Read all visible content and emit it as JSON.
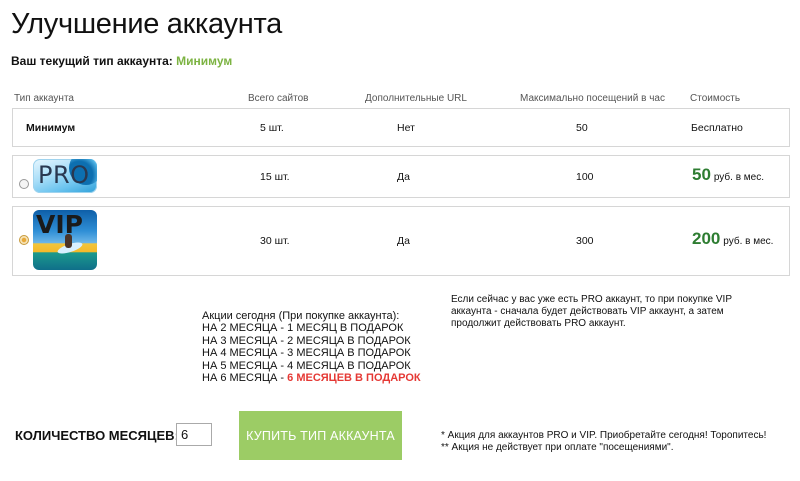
{
  "page": {
    "title": "Улучшение аккаунта",
    "current_type_label": "Ваш текущий тип аккаунта:",
    "current_type_value": "Минимум"
  },
  "columns": {
    "type": "Тип аккаунта",
    "sites": "Всего сайтов",
    "urls": "Дополнительные URL",
    "visits": "Максимально посещений в час",
    "cost": "Стоимость"
  },
  "plans": {
    "minimum": {
      "name": "Минимум",
      "sites": "5 шт.",
      "urls": "Нет",
      "visits": "50",
      "cost": "Бесплатно"
    },
    "pro": {
      "logo": "PRO",
      "sites": "15 шт.",
      "urls": "Да",
      "visits": "100",
      "price": "50",
      "price_unit": "руб. в мес.",
      "selected": false
    },
    "vip": {
      "logo": "VIP",
      "sites": "30 шт.",
      "urls": "Да",
      "visits": "300",
      "price": "200",
      "price_unit": "руб. в мес.",
      "selected": true
    }
  },
  "promo": {
    "heading": "Акции сегодня (При покупке аккаунта):",
    "lines": [
      "НА 2 МЕСЯЦА - 1 МЕСЯЦ В ПОДАРОК",
      "НА 3 МЕСЯЦА - 2 МЕСЯЦА В ПОДАРОК",
      "НА 4 МЕСЯЦА - 3 МЕСЯЦА В ПОДАРОК",
      "НА 5 МЕСЯЦА - 4 МЕСЯЦА В ПОДАРОК"
    ],
    "last_prefix": "НА 6 МЕСЯЦА - ",
    "last_highlight": "6 МЕСЯЦЕВ В ПОДАРОК"
  },
  "note": "Если сейчас у вас уже есть PRO аккаунт, то при покупке VIP аккаунта - сначала будет действовать VIP аккаунт, а затем продолжит действовать PRO аккаунт.",
  "order": {
    "months_label": "КОЛИЧЕСТВО МЕСЯЦЕВ:",
    "months_value": "6",
    "buy_label": "КУПИТЬ ТИП АККАУНТА"
  },
  "footnotes": {
    "one": "* Акция для аккаунтов PRO и VIP. Приобретайте сегодня! Торопитесь!",
    "two": "** Акция не действует при оплате \"посещениями\"."
  },
  "colors": {
    "accent": "#7cb342",
    "price": "#2e7d32",
    "button": "#9ccc65",
    "promo_red": "#e53935"
  }
}
